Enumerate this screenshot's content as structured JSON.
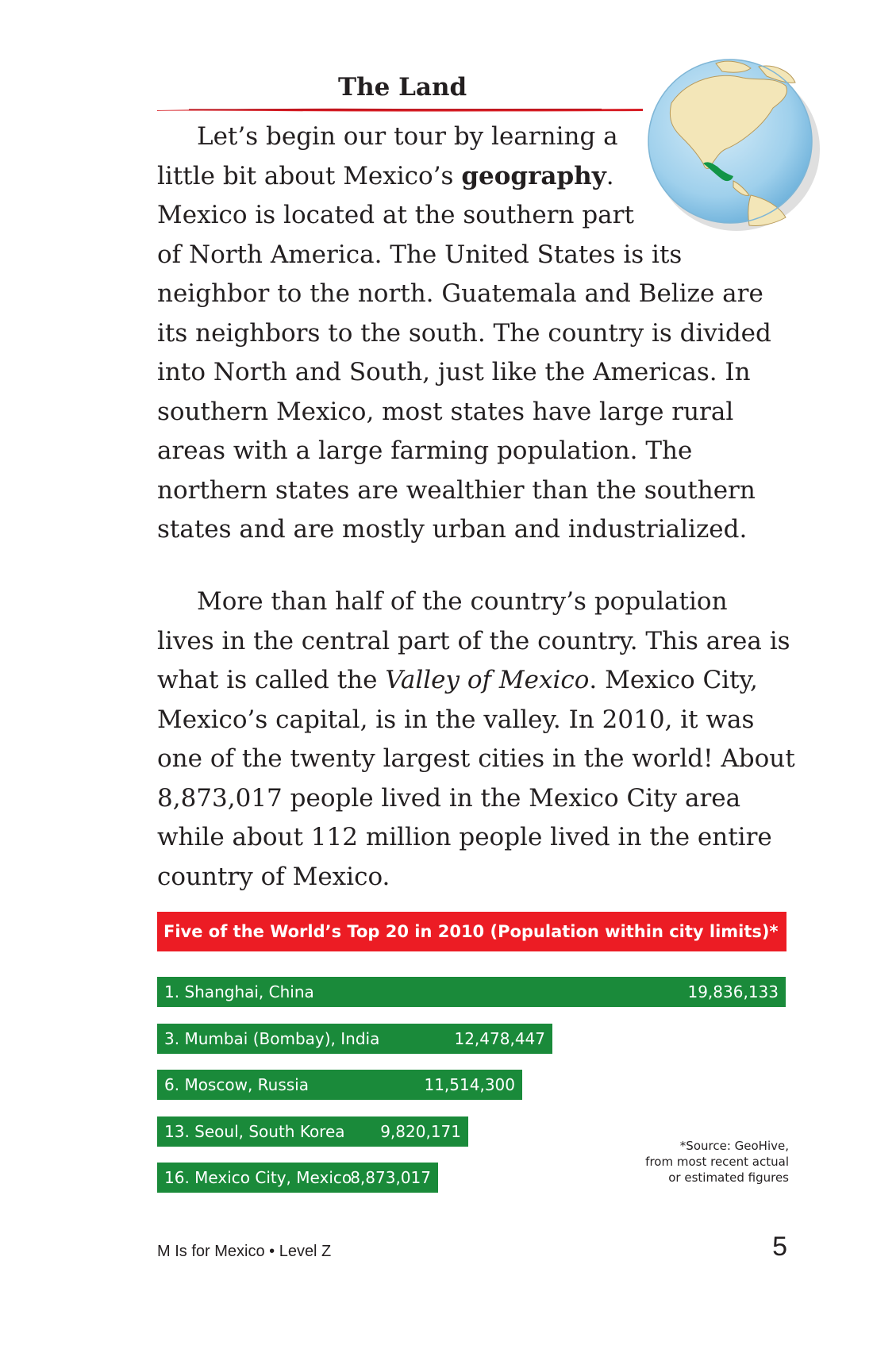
{
  "heading": "The Land",
  "paragraph1": {
    "lines": [
      [
        "Let’s begin our tour by learning a"
      ],
      [
        "little bit about Mexico’s ",
        {
          "b": "geography"
        },
        "."
      ],
      [
        "Mexico is located at the southern part"
      ],
      [
        "of North America. The United States is its"
      ],
      [
        "neighbor to the north. Guatemala and Belize are"
      ],
      [
        "its neighbors to the south. The country is divided"
      ],
      [
        "into North and South, just like the Americas. In"
      ],
      [
        "southern Mexico, most states have large rural"
      ],
      [
        "areas with a large farming population. The"
      ],
      [
        "northern states are wealthier than the southern"
      ],
      [
        "states and are mostly urban and industrialized."
      ]
    ]
  },
  "paragraph2": {
    "lines": [
      [
        "More than half of the country’s population"
      ],
      [
        "lives in the central part of the country. This area is"
      ],
      [
        "what is called the ",
        {
          "i": "Valley of Mexico"
        },
        ". Mexico City,"
      ],
      [
        "Mexico’s capital, is in the valley. In 2010, it was"
      ],
      [
        "one of the twenty largest cities in the world! About"
      ],
      [
        "8,873,017 people lived in the Mexico City area"
      ],
      [
        "while about 112 million people lived in the entire"
      ],
      [
        "country of Mexico."
      ]
    ]
  },
  "chart_data": {
    "type": "bar",
    "orientation": "horizontal",
    "title": "Five of the World’s Top 20 in 2010 (Population within city limits)*",
    "categories": [
      "1. Shanghai, China",
      "3. Mumbai (Bombay), India",
      "6. Moscow, Russia",
      "13. Seoul, South Korea",
      "16. Mexico City, Mexico"
    ],
    "values": [
      19836133,
      12478447,
      11514300,
      9820171,
      8873017
    ],
    "value_labels": [
      "19,836,133",
      "12,478,447",
      "11,514,300",
      "9,820,171",
      "8,873,017"
    ],
    "bar_color": "#1a8a3a",
    "title_color": "#ec1c24"
  },
  "source_note": [
    "*Source: GeoHive,",
    "from most recent actual",
    "or estimated figures"
  ],
  "footer": {
    "book": "M Is for Mexico • Level Z",
    "page": "5"
  },
  "images": {
    "globe": "globe-north-america-icon"
  }
}
